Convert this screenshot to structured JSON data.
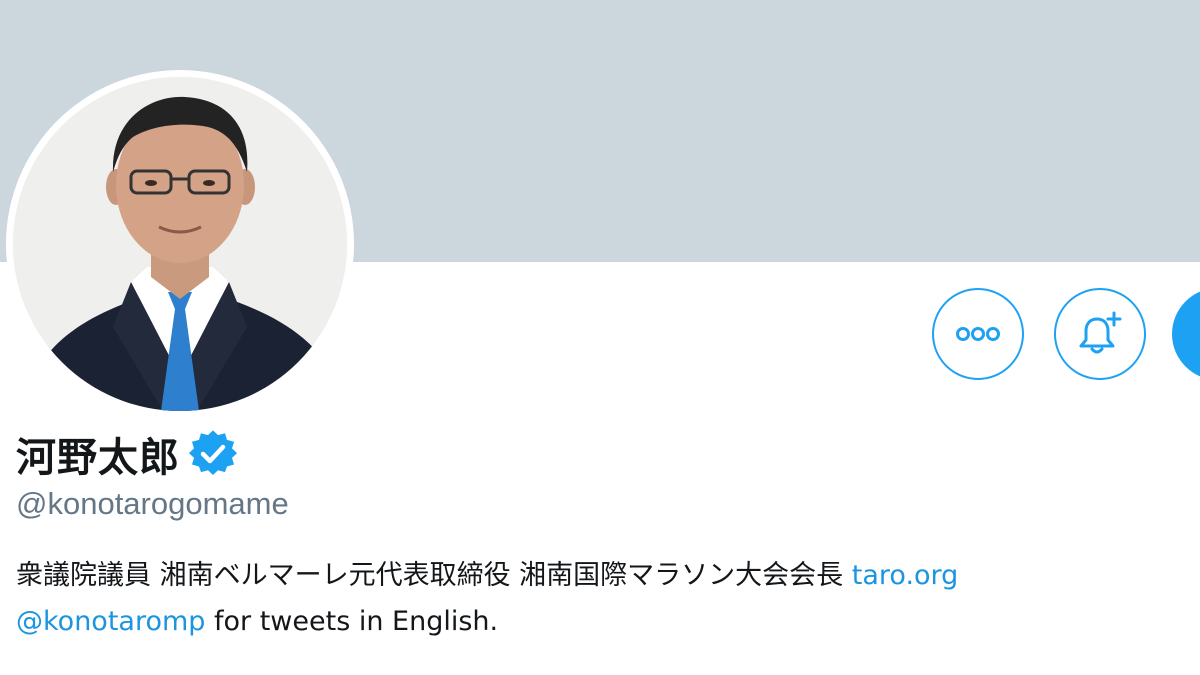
{
  "profile": {
    "display_name": "河野太郎",
    "handle": "@konotarogomame",
    "verified": true,
    "bio": {
      "line1_text": "衆議院議員 湘南ベルマーレ元代表取締役 湘南国際マラソン大会会長",
      "line1_link": "taro.org",
      "line2_mention": "@konotaromp",
      "line2_text": "for tweets in English."
    }
  },
  "actions": {
    "more_icon": "more-dots-icon",
    "notify_icon": "bell-plus-icon"
  },
  "colors": {
    "banner": "#ccd6dd",
    "accent": "#1da1f2",
    "link": "#1b95e0",
    "name_text": "#14171a",
    "handle_text": "#657786"
  }
}
